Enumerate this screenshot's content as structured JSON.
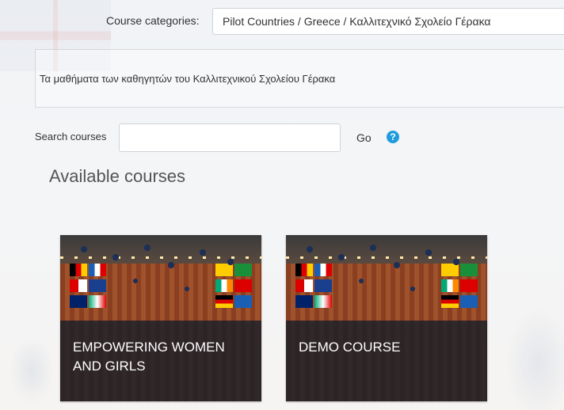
{
  "filters": {
    "category_label": "Course categories:",
    "category_value": "Pilot Countries / Greece / Καλλιτεχνικό Σχολείο Γέρακα"
  },
  "category_description": "Τα μαθήματα των καθηγητών του Καλλιτεχνικού Σχολείου Γέρακα",
  "search": {
    "label": "Search courses",
    "value": "",
    "placeholder": "",
    "go_label": "Go",
    "help_icon": "question-circle-icon",
    "help_color": "#1f9bde"
  },
  "available_courses": {
    "heading": "Available courses",
    "courses": [
      {
        "title": "EMPOWERING WOMEN AND GIRLS"
      },
      {
        "title": "DEMO COURSE"
      }
    ]
  }
}
